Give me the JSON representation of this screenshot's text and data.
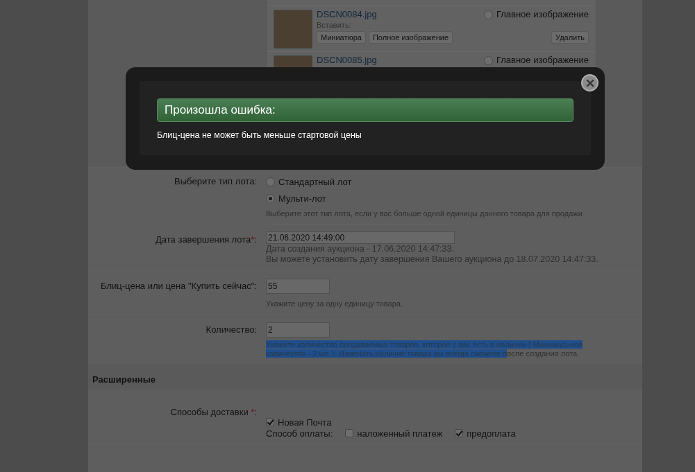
{
  "images": [
    {
      "file": "DSCN0084.jpg",
      "insert_label": "Вставить:",
      "main_label": "Главное изображение",
      "main_selected": false,
      "buttons": [
        "Миниатюра",
        "Полное изображение"
      ],
      "delete": "Удалить",
      "kind": "full"
    },
    {
      "file": "DSCN0085.jpg",
      "main_label": "Главное изображение",
      "main_selected": false,
      "kind": "partial"
    }
  ],
  "lot_type": {
    "label": "Выберите тип лота:",
    "options": [
      {
        "label": "Стандартный лот",
        "selected": false
      },
      {
        "label": "Мульти-лот",
        "selected": true
      }
    ],
    "hint": "Выберите этот тип лота, если у вас больше одной единицы данного товара для продажи"
  },
  "end_date": {
    "label": "Дата завершения лота",
    "required_mark": "*",
    "colon": ":",
    "value": "21.06.2020 14:49:00",
    "notes": [
      "Дата создания аукциона - 17.06.2020 14:47:33.",
      "Вы можете установить дату завершения Вашего аукциона до 18.07.2020 14:47:33."
    ]
  },
  "buy_now": {
    "label": "Блиц-цена или цена \"Купить сейчас\":",
    "value": "55",
    "hint": "Укажите цену за одну единицу товара."
  },
  "quantity": {
    "label": "Количество:",
    "value": "2",
    "hint_selected": "Укажите количество продаваемых товаров, которое у вас есть в наличии ( Минимальное количество - 2 шт. ). Изменить наличие товара вы всегда сможете п",
    "hint_rest": "осле создания лота."
  },
  "section": "Расширенные",
  "delivery": {
    "label": "Способы доставки",
    "required_mark": "*",
    "colon": ":",
    "methods": [
      {
        "label": "Новая Почта",
        "checked": true
      }
    ],
    "payment_label": "Способ оплаты:",
    "payments": [
      {
        "label": "наложенный платеж",
        "checked": false
      },
      {
        "label": "предоплата",
        "checked": true
      }
    ]
  },
  "dialog": {
    "title": "Произошла ошибка:",
    "message": "Блиц-цена не может быть меньше стартовой цены"
  }
}
